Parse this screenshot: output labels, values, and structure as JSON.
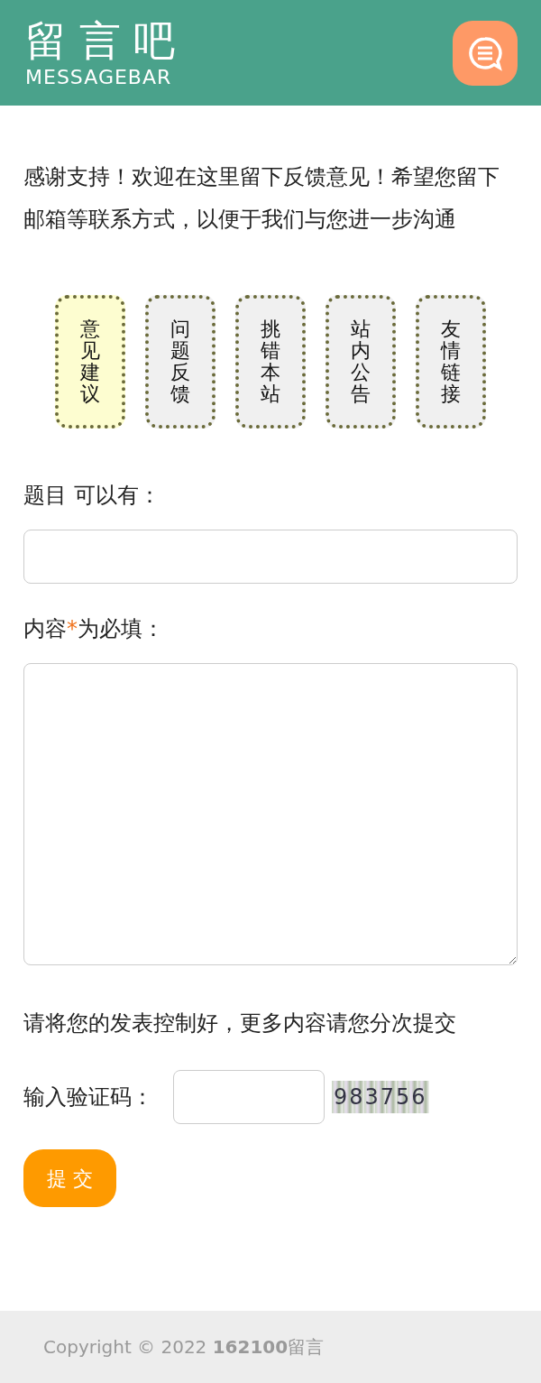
{
  "header": {
    "logo_title": "留言吧",
    "logo_subtitle": "MESSAGEBAR"
  },
  "intro": "感谢支持！欢迎在这里留下反馈意见！希望您留下邮箱等联系方式，以便于我们与您进一步沟通",
  "tabs": [
    {
      "label": "意见建议",
      "selected": true
    },
    {
      "label": "问题反馈",
      "selected": false
    },
    {
      "label": "挑错本站",
      "selected": false
    },
    {
      "label": "站内公告",
      "selected": false
    },
    {
      "label": "友情链接",
      "selected": false
    }
  ],
  "subject": {
    "label": "题目 可以有："
  },
  "content": {
    "label_before": "内容",
    "required_mark": "*",
    "label_after": "为必填："
  },
  "note": "请将您的发表控制好，更多内容请您分次提交",
  "captcha": {
    "label": "输入验证码：",
    "code": "983756"
  },
  "submit": "提 交",
  "footer": "Copyright © 2022 **162100**留言"
}
